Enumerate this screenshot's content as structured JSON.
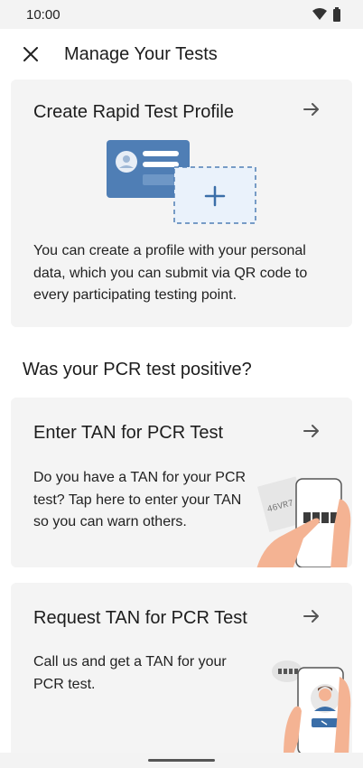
{
  "status_bar": {
    "time": "10:00"
  },
  "toolbar": {
    "title": "Manage Your Tests",
    "close_icon": "close-icon"
  },
  "rapid_card": {
    "title": "Create Rapid Test Profile",
    "body": "You can create a profile with your personal data, which you can submit via QR code to every participating testing point."
  },
  "section": {
    "heading": "Was your PCR test positive?"
  },
  "tan_card": {
    "title": "Enter TAN for PCR Test",
    "body": "Do you have a TAN for your PCR test? Tap here to enter your TAN so you can warn others.",
    "illustration_code": "46VR7"
  },
  "request_card": {
    "title": "Request TAN for PCR Test",
    "body": "Call us and get a TAN for your PCR test."
  },
  "colors": {
    "card_bg": "#f4f4f4",
    "accent_blue": "#4f7eb5",
    "skin": "#f4b393",
    "text": "#1d1d1d"
  }
}
